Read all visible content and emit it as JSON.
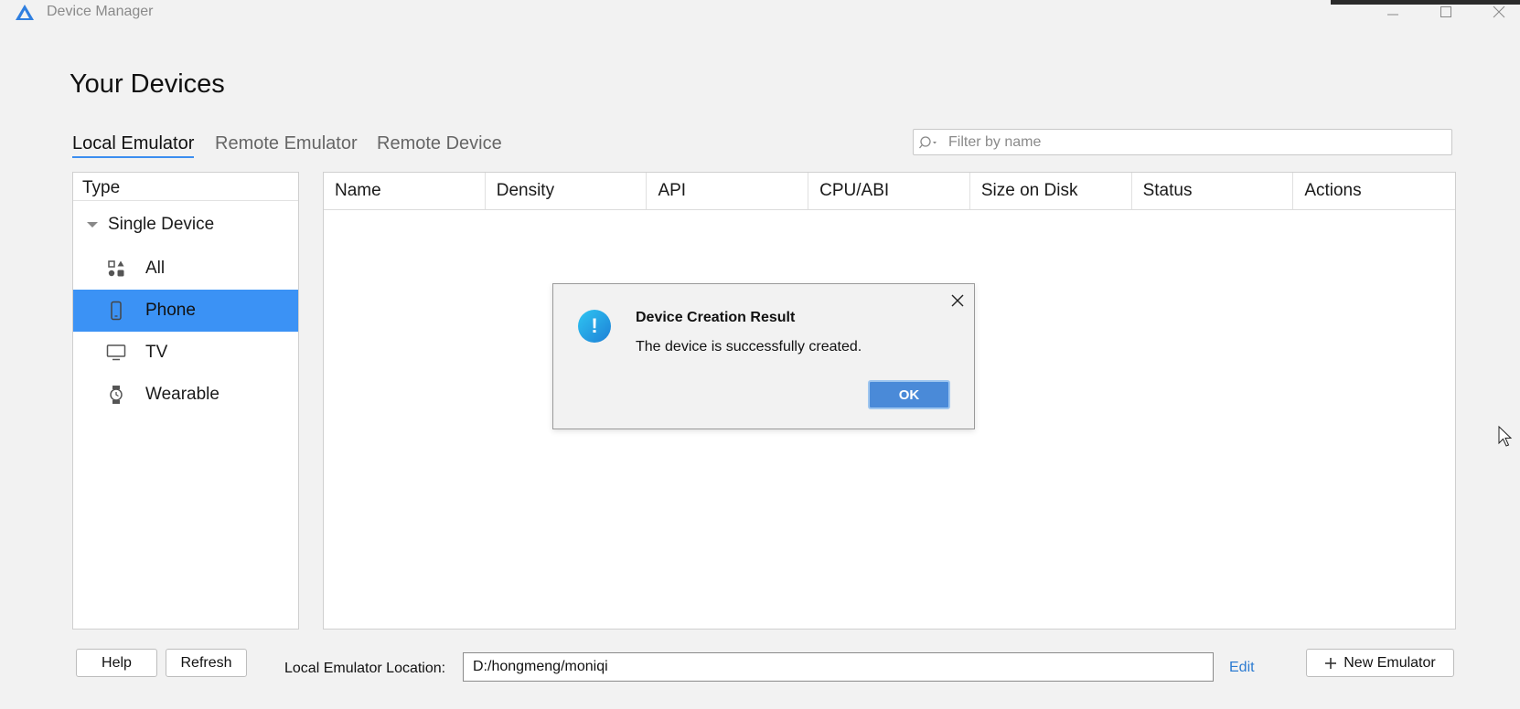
{
  "window": {
    "title": "Device Manager"
  },
  "header": {
    "title": "Your Devices"
  },
  "tabs": [
    {
      "label": "Local Emulator",
      "active": true
    },
    {
      "label": "Remote Emulator",
      "active": false
    },
    {
      "label": "Remote Device",
      "active": false
    }
  ],
  "search": {
    "placeholder": "Filter by name",
    "icon": "search-icon"
  },
  "sidebar": {
    "header": "Type",
    "group": "Single Device",
    "items": [
      {
        "label": "All",
        "icon": "grid-shapes-icon",
        "selected": false
      },
      {
        "label": "Phone",
        "icon": "phone-icon",
        "selected": true
      },
      {
        "label": "TV",
        "icon": "monitor-icon",
        "selected": false
      },
      {
        "label": "Wearable",
        "icon": "watch-icon",
        "selected": false
      }
    ]
  },
  "table": {
    "columns": [
      "Name",
      "Density",
      "API",
      "CPU/ABI",
      "Size on Disk",
      "Status",
      "Actions"
    ],
    "rows": []
  },
  "dialog": {
    "title": "Device Creation Result",
    "message": "The device is successfully created.",
    "ok_label": "OK",
    "icon": "info-exclamation-icon"
  },
  "footer": {
    "help_label": "Help",
    "refresh_label": "Refresh",
    "location_label": "Local Emulator Location:",
    "location_value": "D:/hongmeng/moniqi",
    "edit_label": "Edit",
    "new_emulator_label": "New Emulator"
  },
  "colors": {
    "accent": "#3b92f5",
    "link": "#2b7bd1",
    "ok_button": "#4a8ad8"
  }
}
